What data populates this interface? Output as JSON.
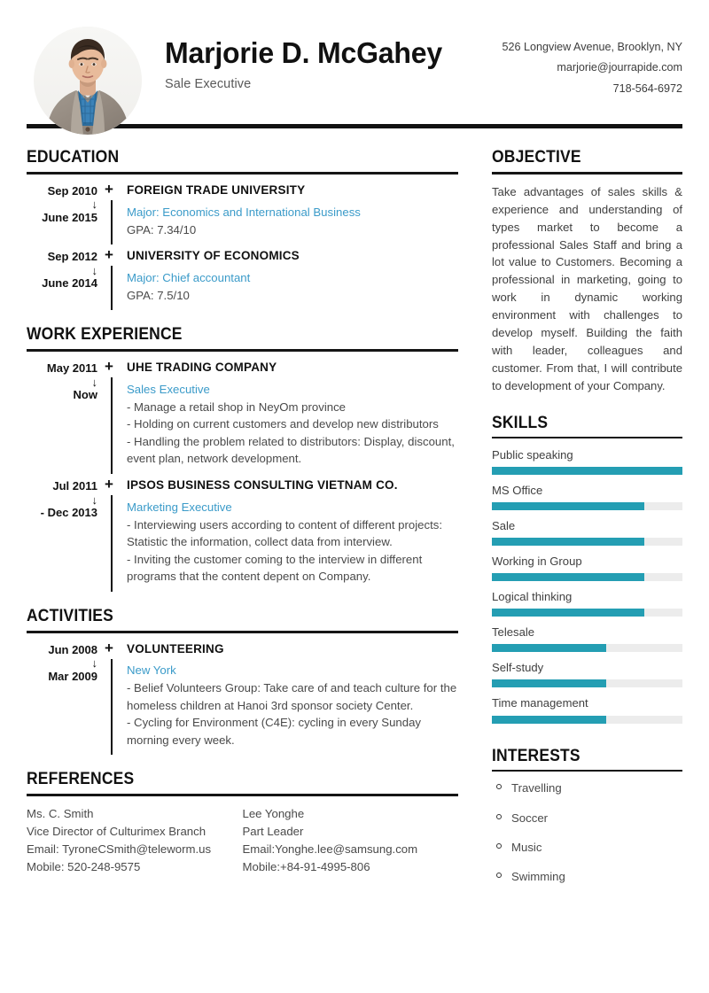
{
  "header": {
    "name": "Marjorie D. McGahey",
    "job_title": "Sale Executive",
    "photo_alt": "profile-photo",
    "contact": {
      "address": "526 Longview Avenue, Brooklyn, NY",
      "email": "marjorie@jourrapide.com",
      "phone": "718-564-6972"
    }
  },
  "colors": {
    "accent_link": "#3b9bc9",
    "accent_bar": "#249eb3",
    "bar_track": "#ececec",
    "rule": "#111111"
  },
  "sections": {
    "education": {
      "title": "EDUCATION",
      "entries": [
        {
          "start": "Sep 2010",
          "arrow": "↓",
          "end": "June 2015",
          "marker": "+",
          "org": "FOREIGN TRADE UNIVERSITY",
          "role": "Major: Economics and International Business",
          "details": [
            "GPA: 7.34/10"
          ]
        },
        {
          "start": "Sep 2012",
          "arrow": "↓",
          "end": "June 2014",
          "marker": "+",
          "org": "UNIVERSITY OF ECONOMICS",
          "role": "Major: Chief accountant",
          "details": [
            "GPA: 7.5/10"
          ]
        }
      ]
    },
    "work_experience": {
      "title": "WORK EXPERIENCE",
      "entries": [
        {
          "start": "May 2011",
          "arrow": "↓",
          "end": "Now",
          "marker": "+",
          "org": "UHE TRADING COMPANY",
          "role": "Sales Executive",
          "details": [
            "- Manage a retail shop in NeyOm province",
            "- Holding on current customers and develop new distributors",
            "- Handling the problem related to distributors: Display, discount, event plan, network development."
          ]
        },
        {
          "start": "Jul 2011",
          "arrow": "↓",
          "end": "- Dec 2013",
          "marker": "+",
          "org": "IPSOS BUSINESS CONSULTING VIETNAM CO.",
          "role": "Marketing Executive",
          "details": [
            "- Interviewing users according to content of different projects: Statistic the information, collect data from interview.",
            "- Inviting the customer coming to the interview in different programs that the content depent on Company."
          ]
        }
      ]
    },
    "activities": {
      "title": "ACTIVITIES",
      "entries": [
        {
          "start": "Jun 2008",
          "arrow": "↓",
          "end": "Mar 2009",
          "marker": "+",
          "org": "VOLUNTEERING",
          "role": "New York",
          "details": [
            "- Belief Volunteers Group: Take care of and teach culture for the homeless children at Hanoi 3rd sponsor society Center.",
            "- Cycling for Environment (C4E): cycling in every Sunday morning every week."
          ]
        }
      ]
    },
    "references": {
      "title": "REFERENCES",
      "people": [
        {
          "name": "Ms. C. Smith",
          "role": "Vice Director of Culturimex Branch",
          "email": "Email: TyroneCSmith@teleworm.us",
          "mobile": "Mobile: 520-248-9575"
        },
        {
          "name": "Lee Yonghe",
          "role": "Part Leader",
          "email": "Email:Yonghe.lee@samsung.com",
          "mobile": "Mobile:+84-91-4995-806"
        }
      ]
    },
    "objective": {
      "title": "OBJECTIVE",
      "text": "Take advantages of sales skills & experience and understanding of types market to become a professional Sales Staff and bring a lot value to Customers. Becoming a professional in marketing, going to work in dynamic working environment with challenges to develop myself. Building the faith with leader, colleagues and customer. From that, I will contribute to development of your Company."
    },
    "skills": {
      "title": "SKILLS",
      "items": [
        {
          "label": "Public speaking",
          "value": 100
        },
        {
          "label": "MS Office",
          "value": 80
        },
        {
          "label": "Sale",
          "value": 80
        },
        {
          "label": "Working in Group",
          "value": 80
        },
        {
          "label": "Logical thinking",
          "value": 80
        },
        {
          "label": "Telesale",
          "value": 60
        },
        {
          "label": "Self-study",
          "value": 60
        },
        {
          "label": "Time management",
          "value": 60
        }
      ]
    },
    "interests": {
      "title": "INTERESTS",
      "items": [
        "Travelling",
        "Soccer",
        "Music",
        "Swimming"
      ]
    }
  }
}
